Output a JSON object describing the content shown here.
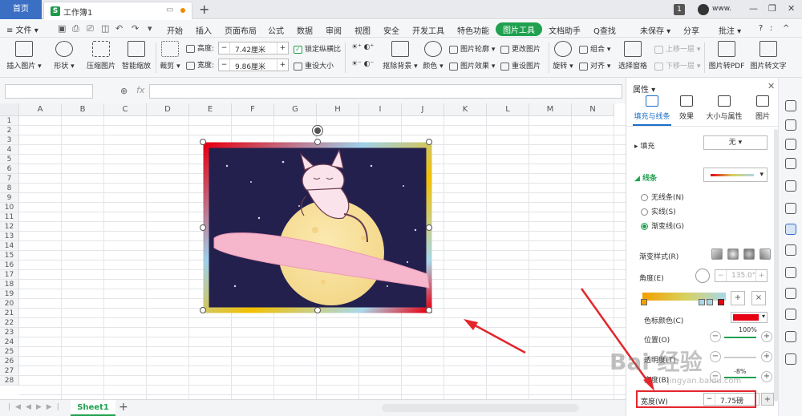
{
  "titlebar": {
    "home_tab": "首页",
    "doc_tab": "工作簿1",
    "badge": "1",
    "user": "www."
  },
  "menubar": {
    "file": "≡ 文件 ▾",
    "items": [
      "开始",
      "插入",
      "页面布局",
      "公式",
      "数据",
      "审阅",
      "视图",
      "安全",
      "开发工具",
      "特色功能",
      "图片工具",
      "文档助手"
    ],
    "active_item": "图片工具",
    "search": "Q查找",
    "unsaved": "未保存 ▾",
    "share": "分享",
    "comment": "批注 ▾"
  },
  "ribbon": {
    "insert_picture": "插入图片 ▾",
    "shape": "形状 ▾",
    "compress": "压缩图片",
    "smart_zoom": "智能缩放",
    "crop": "裁剪 ▾",
    "height_label": "高度:",
    "height_value": "7.42厘米",
    "width_label": "宽度:",
    "width_value": "9.86厘米",
    "lock_ratio": "锁定纵横比",
    "reset_size": "重设大小",
    "remove_bg": "抠除背景 ▾",
    "color": "颜色 ▾",
    "outline": "图片轮廓 ▾",
    "effect": "图片效果 ▾",
    "change_pic": "更改图片",
    "reset_pic": "重设图片",
    "rotate": "旋转 ▾",
    "group": "组合 ▾",
    "align": "对齐 ▾",
    "select_pane": "选择窗格",
    "bring_up": "上移一层 ▾",
    "send_down": "下移一层 ▾",
    "to_pdf": "图片转PDF",
    "to_text": "图片转文字"
  },
  "sheet": {
    "columns": [
      "A",
      "B",
      "C",
      "D",
      "E",
      "F",
      "G",
      "H",
      "I",
      "J",
      "K",
      "L",
      "M",
      "N"
    ],
    "rows": [
      "1",
      "2",
      "3",
      "4",
      "5",
      "6",
      "7",
      "8",
      "9",
      "10",
      "11",
      "12",
      "13",
      "14",
      "15",
      "16",
      "17",
      "18",
      "19",
      "20",
      "21",
      "22",
      "23",
      "24",
      "25",
      "26",
      "27",
      "28"
    ],
    "sheet_tab": "Sheet1"
  },
  "pane": {
    "title": "属性 ▾",
    "tabs": [
      "填充与线条",
      "效果",
      "大小与属性",
      "图片"
    ],
    "fill_label": "▸ 填充",
    "fill_value": "无 ▾",
    "line_label": "◢ 线条",
    "no_line": "无线条(N)",
    "solid_line": "实线(S)",
    "gradient_line": "渐变线(G)",
    "gradient_style": "渐变样式(R)",
    "angle_label": "角度(E)",
    "angle_value": "135.0°",
    "stop_color": "色标颜色(C)",
    "stop_color_hex": "#e60012",
    "position_label": "位置(O)",
    "position_value": "100%",
    "transparency_label": "透明度(T)",
    "brightness_label": "亮度(B)",
    "brightness_value": "-8%",
    "width_label": "宽度(W)",
    "width_value": "7.75磅"
  },
  "watermark": {
    "main": "Bai 经验",
    "sub": "jingyan.baidu.com"
  }
}
